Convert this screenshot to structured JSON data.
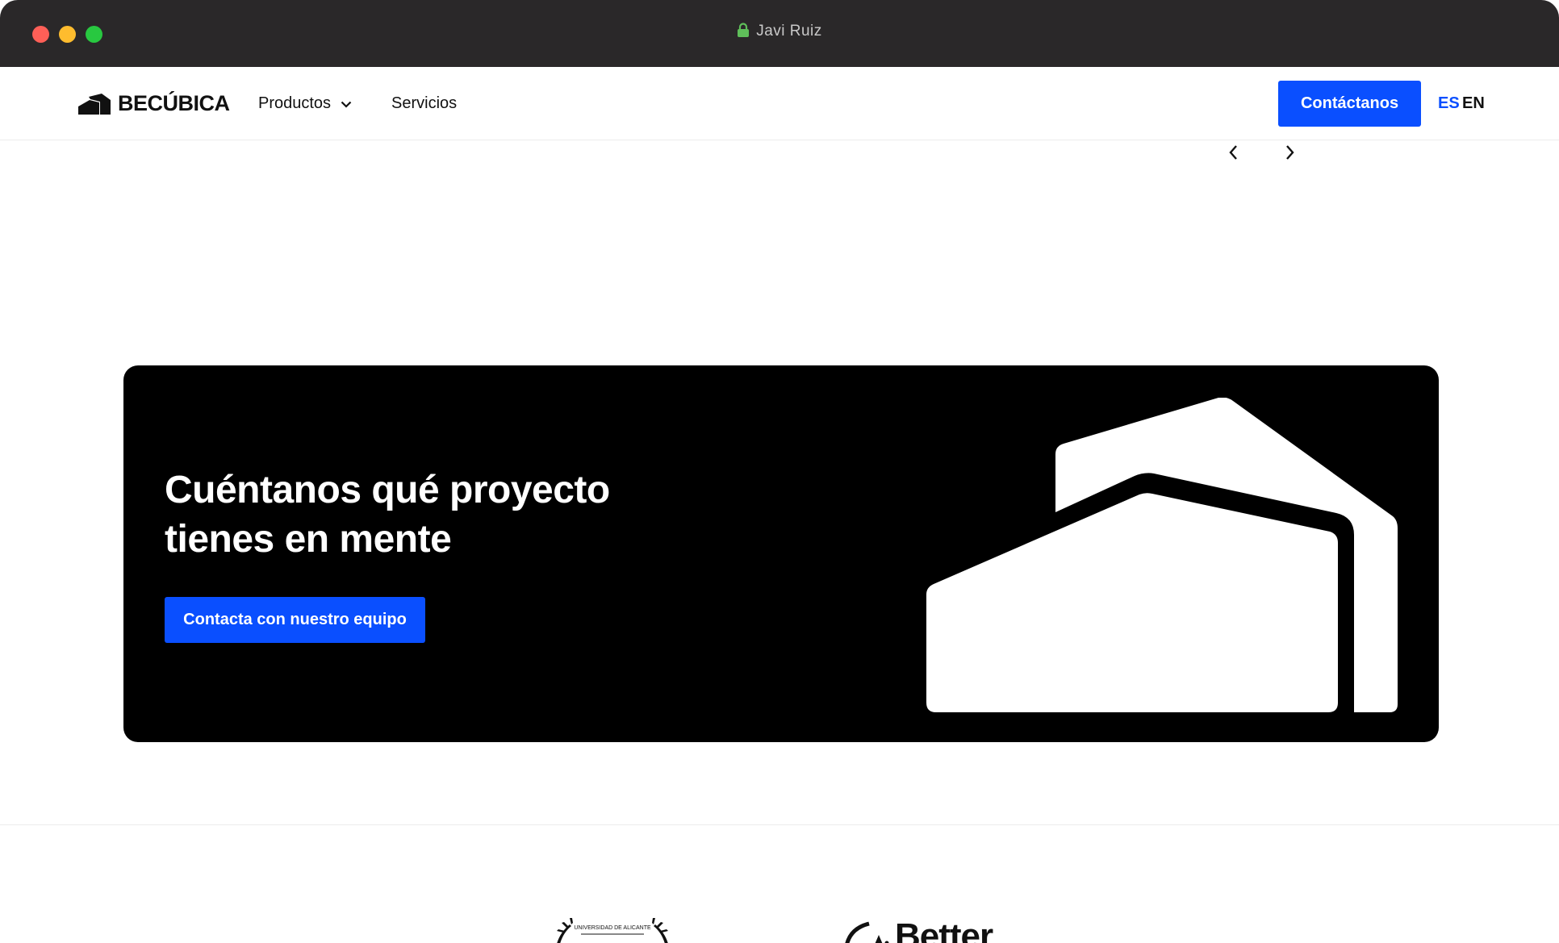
{
  "window": {
    "title": "Javi Ruiz",
    "icons": {
      "lock": "lock-icon"
    }
  },
  "navbar": {
    "logo_text": "BECÚBICA",
    "links": [
      {
        "label": "Productos",
        "has_dropdown": true
      },
      {
        "label": "Servicios",
        "has_dropdown": false
      }
    ],
    "cta_label": "Contáctanos",
    "languages": [
      {
        "code": "ES",
        "active": true
      },
      {
        "code": "EN",
        "active": false
      }
    ]
  },
  "carousel": {
    "icons": {
      "prev": "chevron-left-icon",
      "next": "chevron-right-icon"
    }
  },
  "banner": {
    "title_line1": "Cuéntanos qué proyecto",
    "title_line2": "tienes en mente",
    "cta_label": "Contacta con nuestro equipo",
    "art": "house-outline-illustration"
  },
  "partners": {
    "laurel_caption": "UNIVERSIDAD DE ALICANTE",
    "better_text": "Better"
  },
  "colors": {
    "accent": "#0a4fff",
    "banner_bg": "#000000",
    "titlebar_bg": "#2a2829"
  }
}
